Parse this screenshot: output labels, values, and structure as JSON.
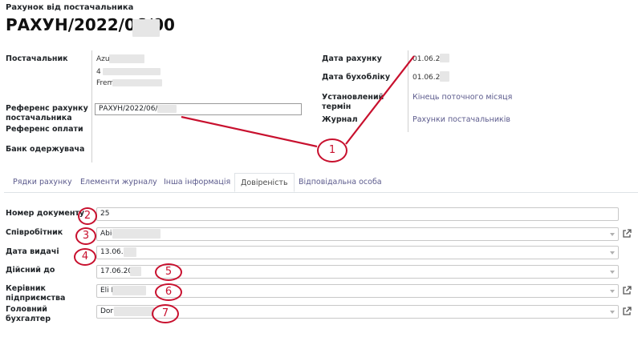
{
  "header": {
    "subtitle": "Рахунок від постачальника",
    "title": "РАХУН/2022/06/00"
  },
  "vendor": {
    "label": "Постачальник",
    "line1": "Azu",
    "line2": "4",
    "line3": "Frem"
  },
  "reference": {
    "label": "Референс рахунку постачальника",
    "value": "РАХУН/2022/06/00",
    "payment_label": "Референс оплати"
  },
  "bank": {
    "label": "Банк одержувача"
  },
  "right_fields": {
    "invoice_date_label": "Дата рахунку",
    "invoice_date_value": "01.06.20",
    "accounting_date_label": "Дата бухобліку",
    "accounting_date_value": "01.06.20",
    "due_label": "Установлений термін",
    "due_value": "Кінець поточного місяця",
    "journal_label": "Журнал",
    "journal_value": "Рахунки постачальників"
  },
  "tabs": [
    {
      "label": "Рядки рахунку"
    },
    {
      "label": "Елементи журналу"
    },
    {
      "label": "Інша інформація"
    },
    {
      "label": "Довіреність"
    },
    {
      "label": "Відповідальна особа"
    }
  ],
  "poa": {
    "doc_number_label": "Номер документу",
    "doc_number_value": "25",
    "employee_label": "Співробітник",
    "employee_value": "Abig",
    "issue_date_label": "Дата видачі",
    "issue_date_value": "13.06.",
    "valid_until_label": "Дійсний до",
    "valid_until_value": "17.06.20",
    "director_label": "Керівник підприємства",
    "director_value": "Eli L",
    "accountant_label": "Головний бухгалтер",
    "accountant_value": "Dori"
  },
  "annotations": {
    "m1": "1",
    "m2": "2",
    "m3": "3",
    "m4": "4",
    "m5": "5",
    "m6": "6",
    "m7": "7"
  },
  "colors": {
    "annotation": "#c8102e",
    "link": "#5b5a8c"
  }
}
